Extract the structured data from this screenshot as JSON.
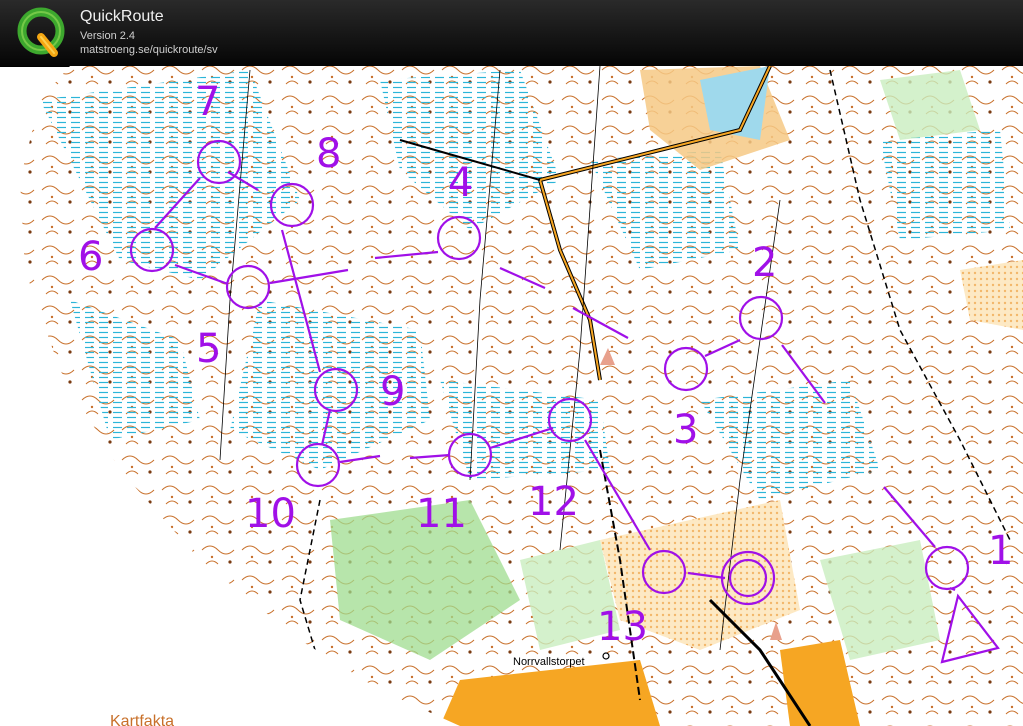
{
  "app": {
    "title": "QuickRoute",
    "version": "Version 2.4",
    "url": "matstroeng.se/quickroute/sv"
  },
  "map": {
    "course_color": "#a010e8",
    "controls": [
      "1",
      "2",
      "3",
      "4",
      "5",
      "6",
      "7",
      "8",
      "9",
      "10",
      "11",
      "12",
      "13"
    ],
    "place_name": "Norrvallstorpet",
    "bottom_label": "Kartfakta"
  }
}
